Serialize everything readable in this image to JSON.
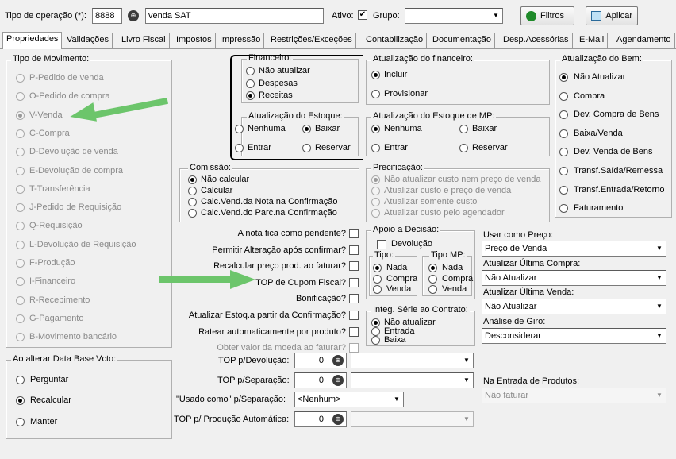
{
  "top": {
    "tipo_label": "Tipo de operação (*):",
    "tipo_code": "8888",
    "tipo_name": "venda SAT",
    "ativo_label": "Ativo:",
    "grupo_label": "Grupo:",
    "filtros": "Filtros",
    "aplicar": "Aplicar"
  },
  "tabs": [
    "Propriedades",
    "Validações",
    "Livro Fiscal",
    "Impostos",
    "Impressão",
    "Restrições/Exceções",
    "Contabilização",
    "Documentação",
    "Desp.Acessórias",
    "E-Mail",
    "Agendamento"
  ],
  "tipo_mov": {
    "title": "Tipo de Movimento:",
    "items": [
      "P-Pedido de venda",
      "O-Pedido de compra",
      "V-Venda",
      "C-Compra",
      "D-Devolução de venda",
      "E-Devolução de compra",
      "T-Transferência",
      "J-Pedido de Requisição",
      "Q-Requisição",
      "L-Devolução de Requisição",
      "F-Produção",
      "I-Financeiro",
      "R-Recebimento",
      "G-Pagamento",
      "B-Movimento bancário"
    ]
  },
  "data_base": {
    "title": "Ao alterar Data Base Vcto:",
    "items": [
      "Perguntar",
      "Recalcular",
      "Manter"
    ]
  },
  "financeiro": {
    "title": "Financeiro:",
    "items": [
      "Não atualizar",
      "Despesas",
      "Receitas"
    ]
  },
  "atual_fin": {
    "title": "Atualização do financeiro:",
    "items": [
      "Incluir",
      "Provisionar"
    ]
  },
  "atual_estoque": {
    "title": "Atualização do Estoque:",
    "items": [
      "Nenhuma",
      "Baixar",
      "Entrar",
      "Reservar"
    ]
  },
  "atual_estoque_mp": {
    "title": "Atualização do Estoque de MP:",
    "items": [
      "Nenhuma",
      "Baixar",
      "Entrar",
      "Reservar"
    ]
  },
  "atual_bem": {
    "title": "Atualização do Bem:",
    "items": [
      "Não Atualizar",
      "Compra",
      "Dev. Compra de Bens",
      "Baixa/Venda",
      "Dev. Venda de Bens",
      "Transf.Saída/Remessa",
      "Transf.Entrada/Retorno",
      "Faturamento"
    ]
  },
  "comissao": {
    "title": "Comissão:",
    "items": [
      "Não calcular",
      "Calcular",
      "Calc.Vend.da Nota na Confirmação",
      "Calc.Vend.do Parc.na Confirmação"
    ]
  },
  "precificacao": {
    "title": "Precificação:",
    "items": [
      "Não atualizar custo nem preço de venda",
      "Atualizar custo e preço de venda",
      "Atualizar somente custo",
      "Atualizar custo pelo agendador"
    ]
  },
  "checks": [
    "A nota fica como pendente?",
    "Permitir Alteração após confirmar?",
    "Recalcular preço prod. ao faturar?",
    "TOP de Cupom Fiscal?",
    "Bonificação?",
    "Atualizar Estoq.a partir da Confirmação?",
    "Ratear automaticamente por produto?",
    "Obter valor da moeda ao faturar?"
  ],
  "apoio": {
    "title": "Apoio a Decisão:",
    "devolucao": "Devolução",
    "tipo_title": "Tipo:",
    "tipo_items": [
      "Nada",
      "Compra",
      "Venda"
    ],
    "tipomp_title": "Tipo MP:",
    "tipomp_items": [
      "Nada",
      "Compra",
      "Venda"
    ]
  },
  "integ": {
    "title": "Integ. Série ao Contrato:",
    "items": [
      "Não atualizar",
      "Entrada",
      "Baixa"
    ]
  },
  "right_fields": {
    "usar_preco_label": "Usar como Preço:",
    "usar_preco_value": "Preço de Venda",
    "ult_compra_label": "Atualizar Última Compra:",
    "ult_compra_value": "Não Atualizar",
    "ult_venda_label": "Atualizar Última Venda:",
    "ult_venda_value": "Não Atualizar",
    "giro_label": "Análise de Giro:",
    "giro_value": "Desconsiderar",
    "entrada_label": "Na Entrada de Produtos:",
    "entrada_value": "Não faturar"
  },
  "bottom": {
    "top_dev_label": "TOP p/Devolução:",
    "top_dev_value": "0",
    "top_sep_label": "TOP p/Separação:",
    "top_sep_value": "0",
    "usado_label": "\"Usado como\" p/Separação:",
    "usado_value": "<Nenhum>",
    "top_prod_label": "TOP p/ Produção Automática:",
    "top_prod_value": "0"
  }
}
